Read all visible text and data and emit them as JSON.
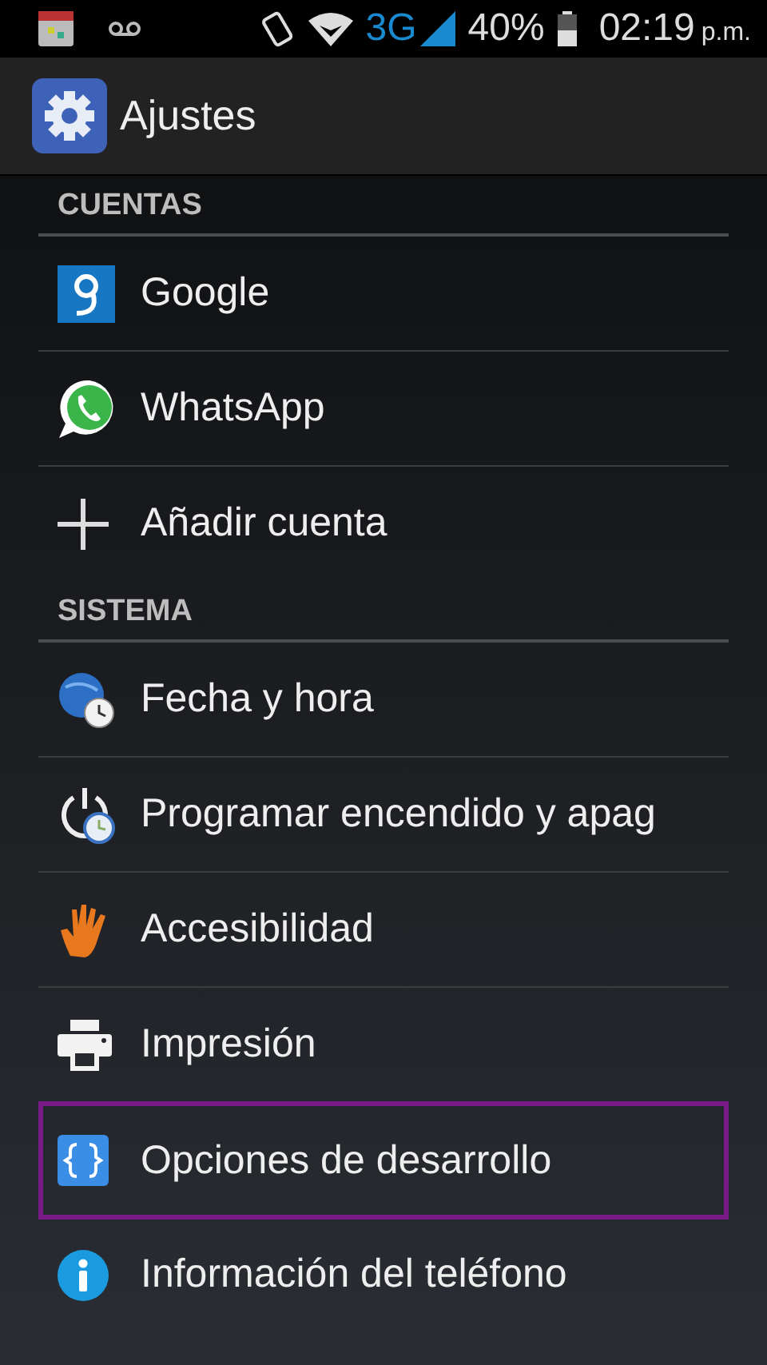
{
  "status_bar": {
    "network": "3G",
    "battery": "40%",
    "time": "02:19",
    "period": "p.m."
  },
  "action_bar": {
    "title": "Ajustes"
  },
  "sections": [
    {
      "title": "CUENTAS",
      "items": [
        {
          "kind": "google",
          "label": "Google",
          "highlighted": false
        },
        {
          "kind": "whatsapp",
          "label": "WhatsApp",
          "highlighted": false
        },
        {
          "kind": "add",
          "label": "Añadir cuenta",
          "highlighted": false
        }
      ]
    },
    {
      "title": "SISTEMA",
      "items": [
        {
          "kind": "datetime",
          "label": "Fecha y hora",
          "highlighted": false
        },
        {
          "kind": "schedule",
          "label": "Programar encendido y apag",
          "highlighted": false
        },
        {
          "kind": "accessibility",
          "label": "Accesibilidad",
          "highlighted": false
        },
        {
          "kind": "print",
          "label": "Impresión",
          "highlighted": false
        },
        {
          "kind": "developer",
          "label": "Opciones de desarrollo",
          "highlighted": true
        },
        {
          "kind": "about",
          "label": "Información del teléfono",
          "highlighted": false
        }
      ]
    }
  ]
}
